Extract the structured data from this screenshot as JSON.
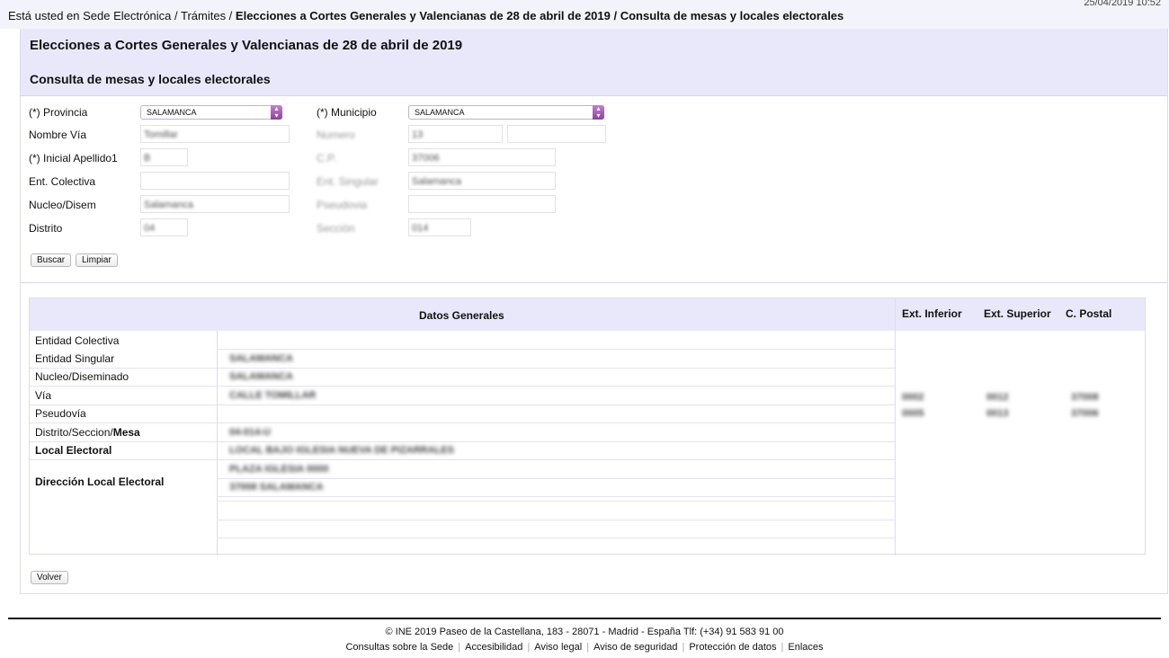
{
  "topbar": {
    "breadcrumb_prefix": "Está usted en Sede Electrónica / Trámites / ",
    "breadcrumb_bold": "Elecciones a Cortes Generales y Valencianas de 28 de abril de 2019 / Consulta de mesas y locales electorales",
    "datetime": "25/04/2019 10:52"
  },
  "header": {
    "title": "Elecciones a Cortes Generales y Valencianas de 28 de abril de 2019",
    "subtitle": "Consulta de mesas y locales electorales"
  },
  "form": {
    "provincia_label": "(*) Provincia",
    "provincia_value": "SALAMANCA",
    "municipio_label": "(*) Municipio",
    "municipio_value": "SALAMANCA",
    "nombre_via_label": "Nombre Vía",
    "nombre_via_value": "Tomillar",
    "numero_label": "Numero",
    "numero_value": "13",
    "inicial_label": "(*) Inicial Apellido1",
    "inicial_value": "B",
    "cp_label": "C.P.",
    "cp_value": "37006",
    "ent_colectiva_label": "Ent. Colectiva",
    "ent_singular_label": "Ent. Singular",
    "ent_singular_value": "Salamanca",
    "nucleo_label": "Nucleo/Disem",
    "nucleo_value": "Salamanca",
    "pseudovia_label": "Pseudovia",
    "distrito_label": "Distrito",
    "distrito_value": "04",
    "seccion_label": "Sección",
    "seccion_value": "014",
    "buscar": "Buscar",
    "limpiar": "Limpiar"
  },
  "results": {
    "header_general": "Datos Generales",
    "header_ext_inf": "Ext. Inferior",
    "header_ext_sup": "Ext. Superior",
    "header_cp": "C. Postal",
    "rows": [
      {
        "label": "Entidad Colectiva",
        "value": ""
      },
      {
        "label": "Entidad Singular",
        "value": "SALAMANCA"
      },
      {
        "label": "Nucleo/Diseminado",
        "value": "SALAMANCA"
      },
      {
        "label": "Vía",
        "value": "CALLE TOMILLAR"
      },
      {
        "label": "Pseudovía",
        "value": ""
      },
      {
        "label": "Distrito/Seccion/",
        "label_bold": "Mesa",
        "value": "04-014-U"
      },
      {
        "label_bold": "Local Electoral",
        "value": "LOCAL BAJO IGLESIA NUEVA DE PIZARRALES"
      },
      {
        "label_bold": "Dirección Local Electoral",
        "value": "PLAZA IGLESIA 0000",
        "value2": "37008 SALAMANCA"
      }
    ],
    "ext": [
      {
        "inf": "0002",
        "sup": "0012",
        "cp": "37008"
      },
      {
        "inf": "0005",
        "sup": "0013",
        "cp": "37006"
      }
    ],
    "volver": "Volver"
  },
  "footer": {
    "line1": "©  INE 2019      Paseo de la Castellana, 183 - 28071 - Madrid - España Tlf: (+34) 91 583 91 00",
    "links": [
      "Consultas sobre la Sede",
      "Accesibilidad",
      "Aviso legal",
      "Aviso de seguridad",
      "Protección de datos",
      "Enlaces"
    ]
  }
}
